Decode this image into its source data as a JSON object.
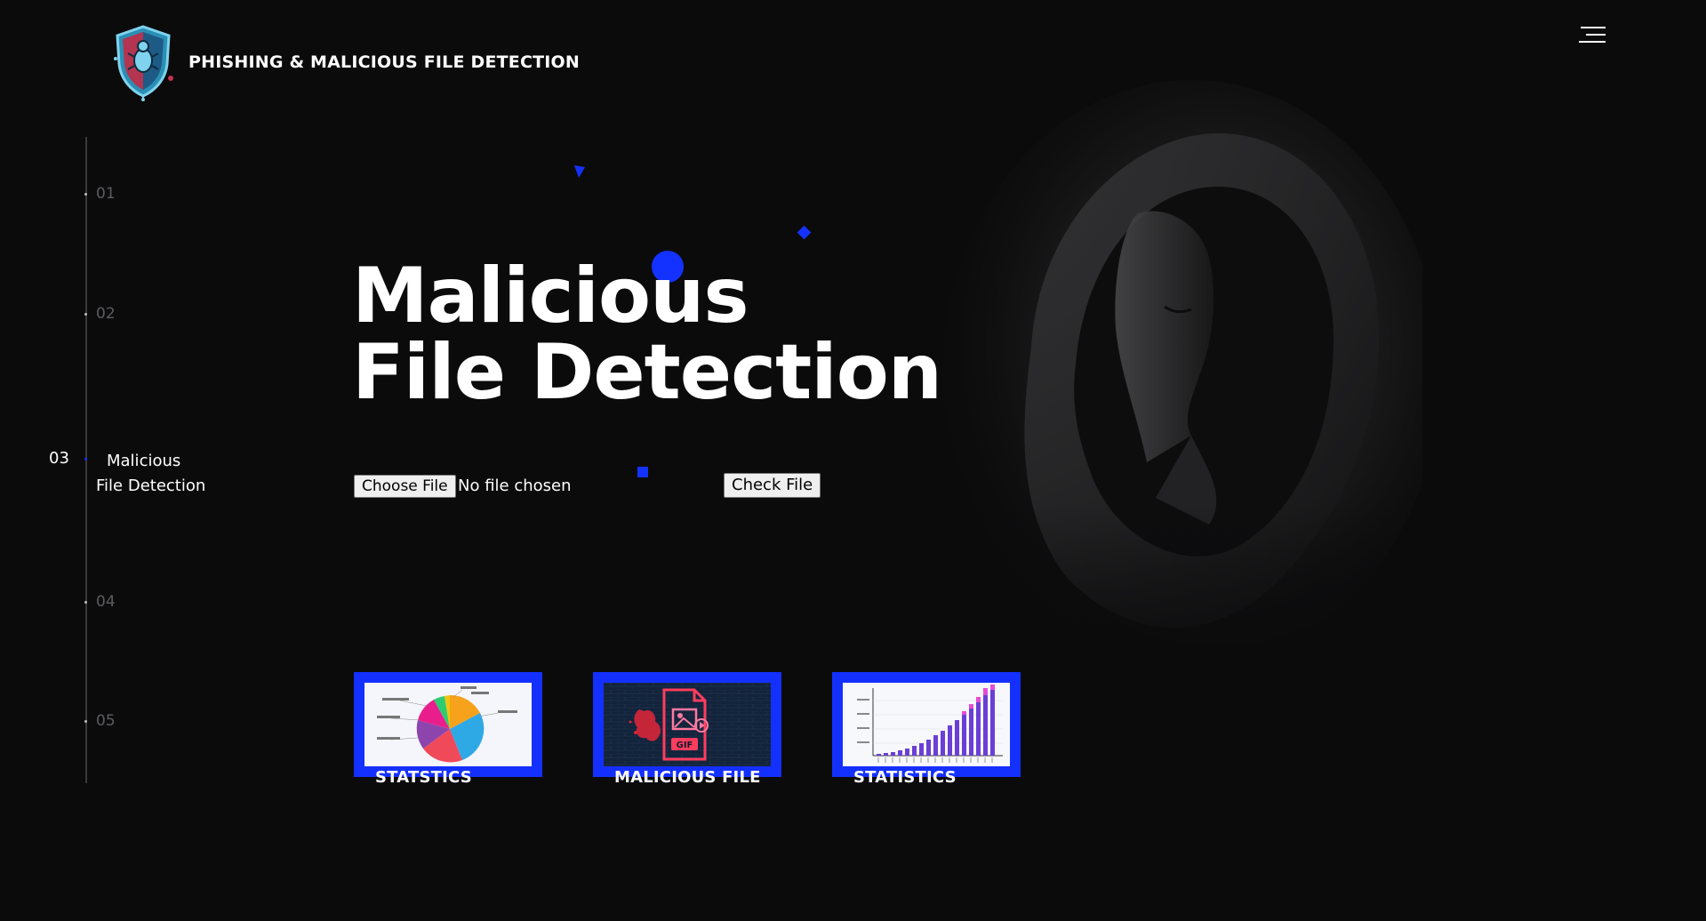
{
  "brand": {
    "title": "PHISHING & MALICIOUS FILE DETECTION",
    "logo_icon": "shield-bug-icon"
  },
  "header": {
    "menu_icon": "hamburger-menu-icon"
  },
  "slide_nav": {
    "items": [
      {
        "number": "01"
      },
      {
        "number": "02"
      },
      {
        "number": "03",
        "label_line1": "Malicious",
        "label_line2": "File Detection",
        "active": true
      },
      {
        "number": "04"
      },
      {
        "number": "05"
      }
    ]
  },
  "hero": {
    "title_line1": "Malicious",
    "title_line2": "File Detection"
  },
  "file_form": {
    "choose_label": "Choose File",
    "status_text": "No file chosen",
    "check_label": "Check File"
  },
  "cards": [
    {
      "label": "STATSTICS",
      "thumb": "pie-chart-thumbnail"
    },
    {
      "label": "MALICIOUS FILE",
      "thumb": "malicious-gif-file-thumbnail"
    },
    {
      "label": "STATISTICS",
      "thumb": "bar-chart-thumbnail"
    }
  ],
  "colors": {
    "background": "#0b0b0c",
    "accent": "#1432ff",
    "text": "#ffffff",
    "muted": "#5d5d60"
  }
}
